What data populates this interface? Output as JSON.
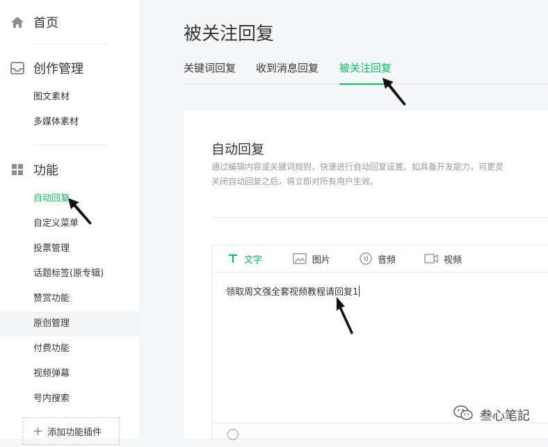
{
  "sidebar": {
    "home": {
      "label": "首页",
      "icon": "home-icon"
    },
    "creation": {
      "title": "创作管理",
      "icon": "inbox-icon",
      "items": [
        "图文素材",
        "多媒体素材"
      ]
    },
    "features": {
      "title": "功能",
      "icon": "grid-icon",
      "items": [
        "自动回复",
        "自定义菜单",
        "投票管理",
        "话题标签(原专辑)",
        "赞赏功能",
        "原创管理",
        "付费功能",
        "视频弹幕",
        "号内搜索"
      ],
      "active_index": 0,
      "hover_index": 5
    },
    "add_plugin": "添加功能插件"
  },
  "main": {
    "title": "被关注回复",
    "tabs": [
      "关键词回复",
      "收到消息回复",
      "被关注回复"
    ],
    "active_tab": 2,
    "panel": {
      "title": "自动回复",
      "desc_line1": "通过编辑内容或关键词规则，快速进行自动回复设置。如具备开发能力，可更灵",
      "desc_line2": "关闭自动回复之后，将立即对所有用户生效。",
      "editor": {
        "tools": [
          {
            "label": "文字",
            "icon": "text-icon"
          },
          {
            "label": "图片",
            "icon": "image-icon"
          },
          {
            "label": "音频",
            "icon": "audio-icon"
          },
          {
            "label": "视频",
            "icon": "video-icon"
          }
        ],
        "active_tool": 0,
        "content": "领取周文强全套视频教程请回复1"
      }
    }
  },
  "watermark": "叁心笔記",
  "colors": {
    "accent": "#07c160",
    "text": "#353535",
    "muted": "#9a9a9a",
    "border": "#e7e7eb"
  }
}
